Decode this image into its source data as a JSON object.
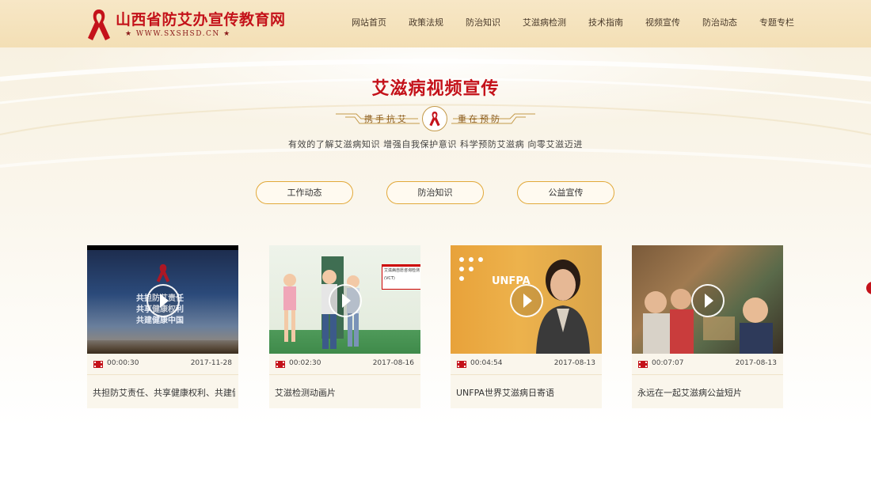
{
  "site": {
    "logo_title": "山西省防艾办宣传教育网",
    "logo_sub": "★ WWW.SXSHSD.CN ★"
  },
  "nav": {
    "items": [
      "网站首页",
      "政策法规",
      "防治知识",
      "艾滋病检测",
      "技术指南",
      "视频宣传",
      "防治动态",
      "专题专栏"
    ]
  },
  "section": {
    "title": "艾滋病视频宣传",
    "divider_left": "携手抗艾",
    "divider_right": "重在预防",
    "tagline": "有效的了解艾滋病知识 增强自我保护意识 科学预防艾滋病 向零艾滋迈进"
  },
  "tabs": [
    "工作动态",
    "防治知识",
    "公益宣传"
  ],
  "videos": [
    {
      "duration": "00:00:30",
      "date": "2017-11-28",
      "title": "共担防艾责任、共享健康权利、共建健康中国",
      "thumb_lines": [
        "共担防艾责任",
        "共享健康权利",
        "共建健康中国"
      ]
    },
    {
      "duration": "00:02:30",
      "date": "2017-08-16",
      "title": "艾滋检测动画片",
      "sign_title": "艾滋病自愿咨询检测",
      "sign_code": "(VCT)"
    },
    {
      "duration": "00:04:54",
      "date": "2017-08-13",
      "title": "UNFPA世界艾滋病日寄语",
      "logo_text": "UNFPA"
    },
    {
      "duration": "00:07:07",
      "date": "2017-08-13",
      "title": "永远在一起艾滋病公益短片"
    }
  ],
  "colors": {
    "brand_red": "#c4121a",
    "header_bg": "#f5e3bd",
    "tab_border": "#e2a93a"
  }
}
